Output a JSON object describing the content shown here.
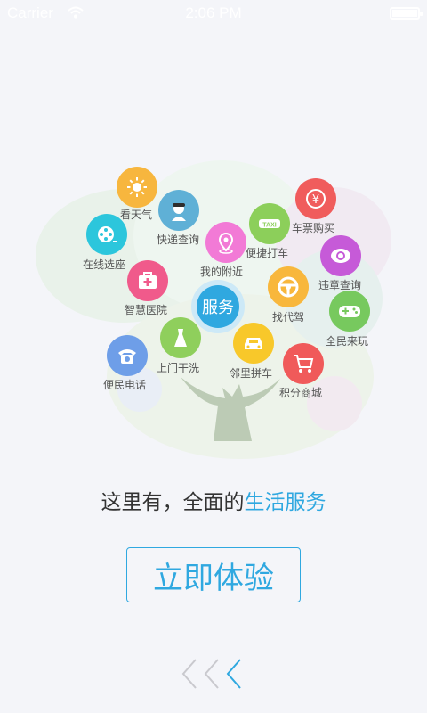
{
  "status_bar": {
    "carrier": "Carrier",
    "time": "2:06 PM"
  },
  "center_label": "服务",
  "services": [
    {
      "id": "weather",
      "label": "看天气",
      "color": "#f7b63e",
      "icon": "sun-icon"
    },
    {
      "id": "express",
      "label": "快递查询",
      "color": "#5fb0d6",
      "icon": "courier-icon"
    },
    {
      "id": "cinema",
      "label": "在线选座",
      "color": "#2cc6dc",
      "icon": "film-reel-icon"
    },
    {
      "id": "nearby",
      "label": "我的附近",
      "color": "#f27ad6",
      "icon": "location-pin-icon"
    },
    {
      "id": "taxi",
      "label": "便捷打车",
      "color": "#8ccf5a",
      "icon": "taxi-icon",
      "icon_text": "TAXI"
    },
    {
      "id": "ticket",
      "label": "车票购买",
      "color": "#f05c5c",
      "icon": "yen-icon",
      "icon_text": "¥"
    },
    {
      "id": "violation",
      "label": "违章查询",
      "color": "#c65ad8",
      "icon": "traffic-violation-icon"
    },
    {
      "id": "hospital",
      "label": "智慧医院",
      "color": "#f05a8b",
      "icon": "medical-kit-icon"
    },
    {
      "id": "driver",
      "label": "找代驾",
      "color": "#f8b73c",
      "icon": "steering-wheel-icon"
    },
    {
      "id": "games",
      "label": "全民来玩",
      "color": "#77c95e",
      "icon": "gamepad-icon"
    },
    {
      "id": "laundry",
      "label": "上门干洗",
      "color": "#8fcf5c",
      "icon": "dress-icon"
    },
    {
      "id": "carpool",
      "label": "邻里拼车",
      "color": "#f8c82a",
      "icon": "car-icon"
    },
    {
      "id": "mall",
      "label": "积分商城",
      "color": "#f05a5a",
      "icon": "shopping-cart-icon"
    },
    {
      "id": "phone",
      "label": "便民电话",
      "color": "#6e9ee8",
      "icon": "telephone-icon"
    }
  ],
  "tagline": {
    "prefix": "这里有，全面的",
    "highlight": "生活服务"
  },
  "cta_label": "立即体验"
}
